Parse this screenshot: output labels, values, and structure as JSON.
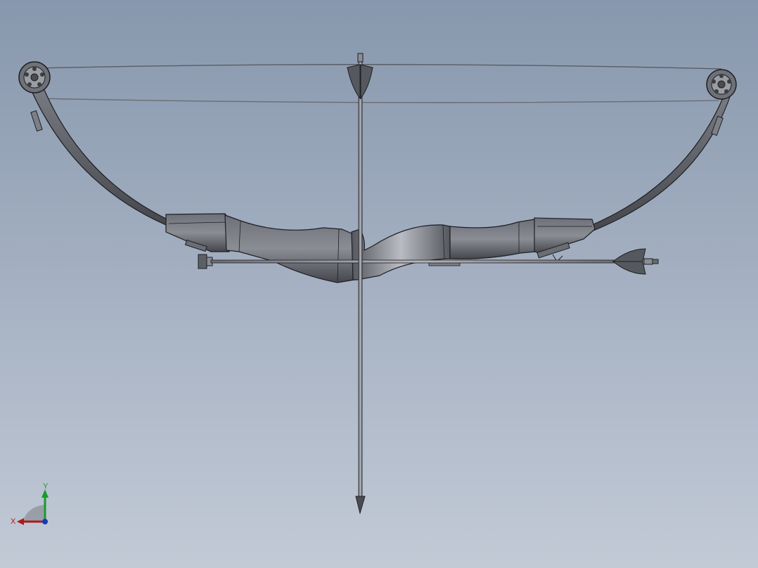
{
  "viewport": {
    "background_top": "#8797ad",
    "background_bottom": "#c2cad6"
  },
  "model": {
    "parts": [
      "compound-bow-riser",
      "upper-limb",
      "lower-limb",
      "top-cam",
      "bottom-cam",
      "bow-string",
      "cable",
      "arrow-vertical",
      "arrow-horizontal",
      "arrow-rest",
      "sight-mount"
    ],
    "body_color": "#5c5f66",
    "edge_color": "#1e1f22"
  },
  "triad": {
    "x_label": "X",
    "y_label": "Y",
    "x_color": "#b01818",
    "y_color": "#1a9a2a",
    "z_color": "#1a3ab8"
  }
}
